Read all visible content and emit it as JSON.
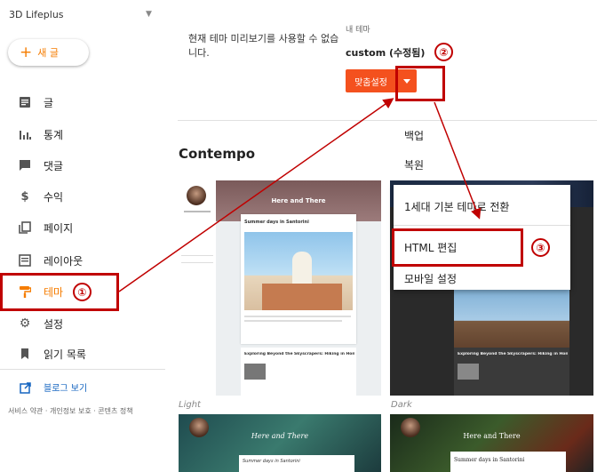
{
  "sidebar": {
    "blog_name": "3D Lifeplus",
    "new_post_label": "새 글",
    "items": [
      {
        "label": "글",
        "icon": "post-icon"
      },
      {
        "label": "통계",
        "icon": "stats-icon"
      },
      {
        "label": "댓글",
        "icon": "comment-icon"
      },
      {
        "label": "수익",
        "icon": "dollar-icon"
      },
      {
        "label": "페이지",
        "icon": "pages-icon"
      },
      {
        "label": "레이아웃",
        "icon": "layout-icon"
      },
      {
        "label": "테마",
        "icon": "paint-roller-icon",
        "active": true
      },
      {
        "label": "설정",
        "icon": "gear-icon"
      },
      {
        "label": "읽기 목록",
        "icon": "bookmark-icon"
      }
    ],
    "view_blog_label": "블로그 보기",
    "footer": "서비스 약관 · 개인정보 보호 · 콘텐츠 정책"
  },
  "main": {
    "preview_unavailable": "현재 테마 미리보기를 사용할 수 없습니다.",
    "my_theme_label": "내 테마",
    "my_theme_name": "custom (수정됨)",
    "customize_button": "맞춤설정",
    "section_title": "Contempo"
  },
  "menu": {
    "backup": "백업",
    "restore": "복원",
    "switch_classic": "1세대 기본 테마로 전환",
    "edit_html": "HTML 편집",
    "mobile_settings": "모바일 설정"
  },
  "themes": {
    "light_caption": "Light",
    "dark_caption": "Dark",
    "header_title": "Here and There",
    "post1_title": "Summer days in Santorini",
    "post2_title": "Exploring Beyond the Skyscrapers: Hiking in Hong Kong",
    "bottom_left_title": "Here and There",
    "bottom_right_title": "Here and There",
    "bottom_post_title": "Summer days in Santorini"
  },
  "annotations": {
    "n1": "①",
    "n2": "②",
    "n3": "③"
  },
  "colors": {
    "accent": "#f57c00",
    "button": "#f4511e",
    "annotation": "#c00000",
    "link": "#1565c0"
  }
}
